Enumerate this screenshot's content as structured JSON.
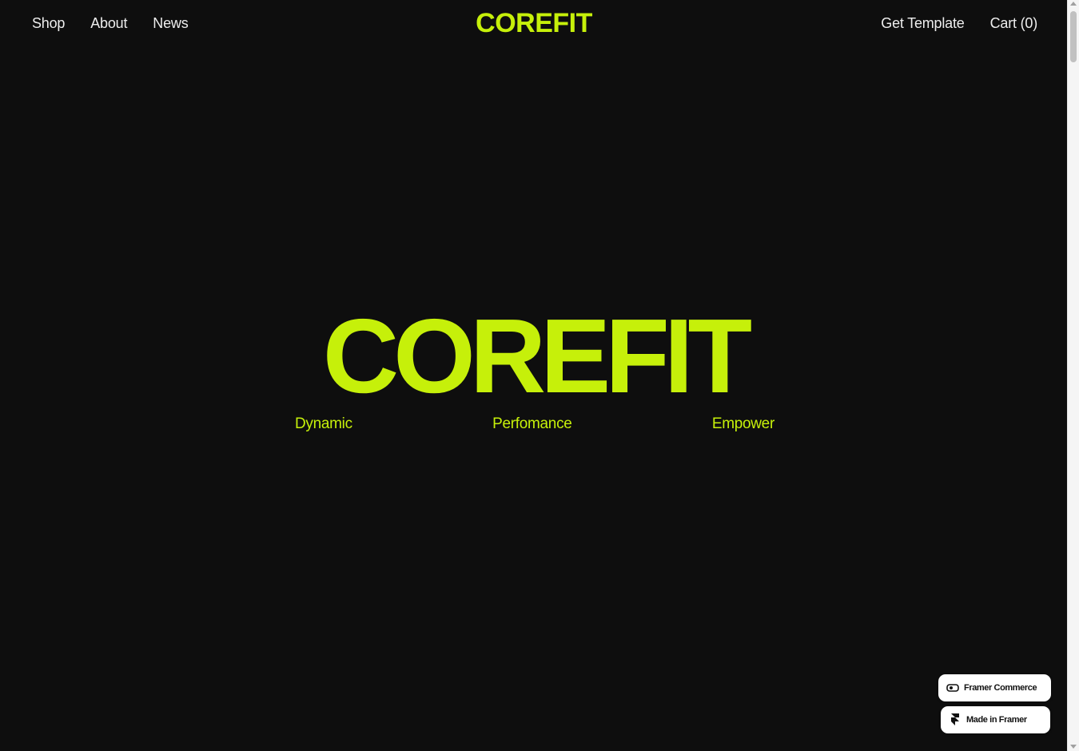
{
  "nav": {
    "left": [
      "Shop",
      "About",
      "News"
    ],
    "brand": "COREFIT",
    "get_template": "Get Template",
    "cart": "Cart (0)"
  },
  "hero": {
    "title": "COREFIT",
    "tags": [
      "Dynamic",
      "Perfomance",
      "Empower"
    ]
  },
  "badges": {
    "commerce": "Framer Commerce",
    "made_in": "Made in Framer"
  },
  "colors": {
    "accent": "#c6f00a",
    "background": "#0e0e0e",
    "nav_text": "#ededed"
  },
  "icons": {
    "commerce": "framer-commerce-icon",
    "framer": "framer-logo-icon"
  }
}
